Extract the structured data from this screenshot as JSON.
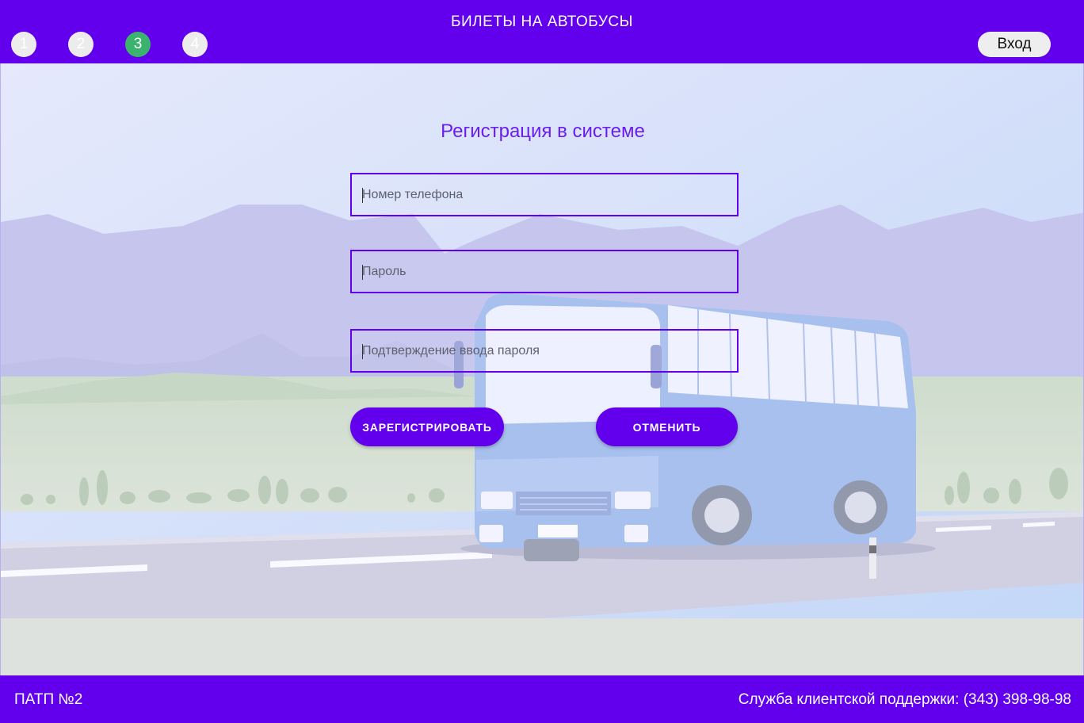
{
  "header": {
    "title": "БИЛЕТЫ НА АВТОБУСЫ",
    "steps": [
      "1",
      "2",
      "3",
      "4"
    ],
    "active_step": "3",
    "login_label": "Вход"
  },
  "form": {
    "title": "Регистрация в системе",
    "phone_placeholder": "Номер телефона",
    "password_placeholder": "Пароль",
    "confirm_placeholder": "Подтверждение ввода пароля",
    "register_label": "ЗАРЕГИСТРИРОВАТЬ",
    "cancel_label": "ОТМЕНИТЬ"
  },
  "footer": {
    "company": "ПАТП №2",
    "support": "Служба клиентской поддержки: (343) 398-98-98"
  },
  "colors": {
    "primary": "#6200ee",
    "step_active": "#3ab36d",
    "step_inactive": "#ececec"
  },
  "icons": {
    "background": "bus-landscape-illustration"
  }
}
